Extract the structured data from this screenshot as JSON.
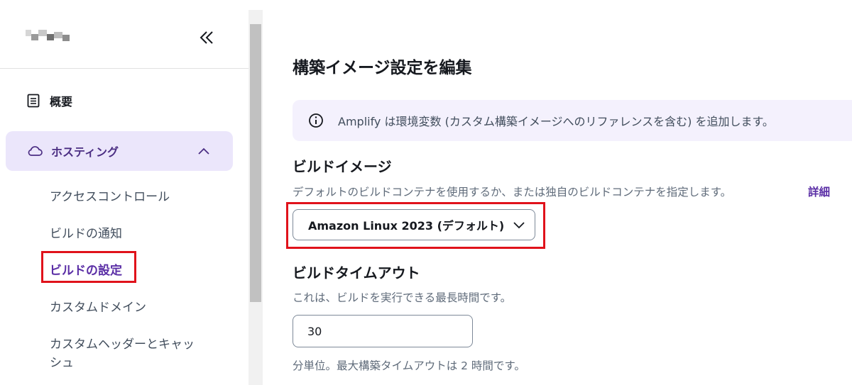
{
  "sidebar": {
    "nav_overview": "概要",
    "hosting_label": "ホスティング",
    "sub_items": [
      {
        "label": "アクセスコントロール"
      },
      {
        "label": "ビルドの通知"
      },
      {
        "label": "ビルドの設定"
      },
      {
        "label": "カスタムドメイン"
      },
      {
        "label": "カスタムヘッダーとキャッ"
      },
      {
        "label": "シュ"
      }
    ]
  },
  "main": {
    "title": "構築イメージ設定を編集",
    "info_text": "Amplify は環境変数 (カスタム構築イメージへのリファレンスを含む) を追加します。",
    "build_image": {
      "heading": "ビルドイメージ",
      "description": "デフォルトのビルドコンテナを使用するか、または独自のビルドコンテナを指定します。",
      "info_link": "詳細",
      "selected": "Amazon Linux 2023 (デフォルト)"
    },
    "timeout": {
      "heading": "ビルドタイムアウト",
      "description": "これは、ビルドを実行できる最長時間です。",
      "value": "30",
      "hint": "分単位。最大構築タイムアウトは 2 時間です。"
    }
  },
  "colors": {
    "accent": "#5b2fa6",
    "highlight_box": "#e0121b",
    "active_bg": "#ebe6fb",
    "info_bg": "#f4f1fd"
  },
  "icons": {
    "collapse": "double-chevron-left-icon",
    "overview": "document-icon",
    "hosting": "cloud-icon",
    "expanded": "chevron-up-icon",
    "info": "info-icon",
    "dropdown": "chevron-down-icon"
  }
}
